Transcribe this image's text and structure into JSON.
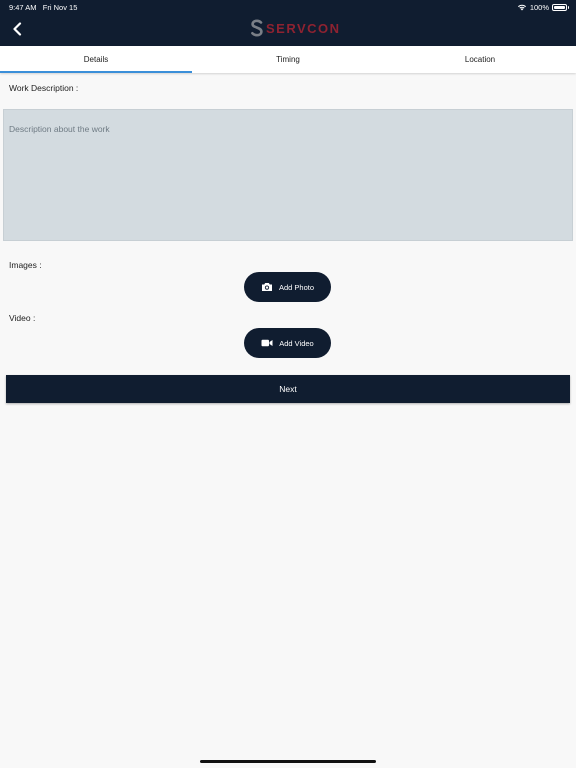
{
  "status_bar": {
    "time": "9:47 AM",
    "date": "Fri Nov 15",
    "battery": "100%",
    "battery_level": 1.0
  },
  "header": {
    "back_icon": "chevron-left-icon",
    "logo_text": "SERVCON",
    "logo_color": "#8e2230",
    "background": "#101d30"
  },
  "tabs": [
    {
      "label": "Details",
      "active": true
    },
    {
      "label": "Timing",
      "active": false
    },
    {
      "label": "Location",
      "active": false
    }
  ],
  "form": {
    "work_description_label": "Work Description :",
    "description_placeholder": "Description about the work",
    "description_value": "",
    "images_label": "Images :",
    "add_photo_label": "Add Photo",
    "add_photo_icon": "camera-icon",
    "video_label": "Video :",
    "add_video_label": "Add Video",
    "add_video_icon": "video-camera-icon",
    "next_label": "Next"
  },
  "colors": {
    "accent": "#3b8fd9",
    "primary": "#101d30",
    "textarea_bg": "#d3dbe0"
  }
}
